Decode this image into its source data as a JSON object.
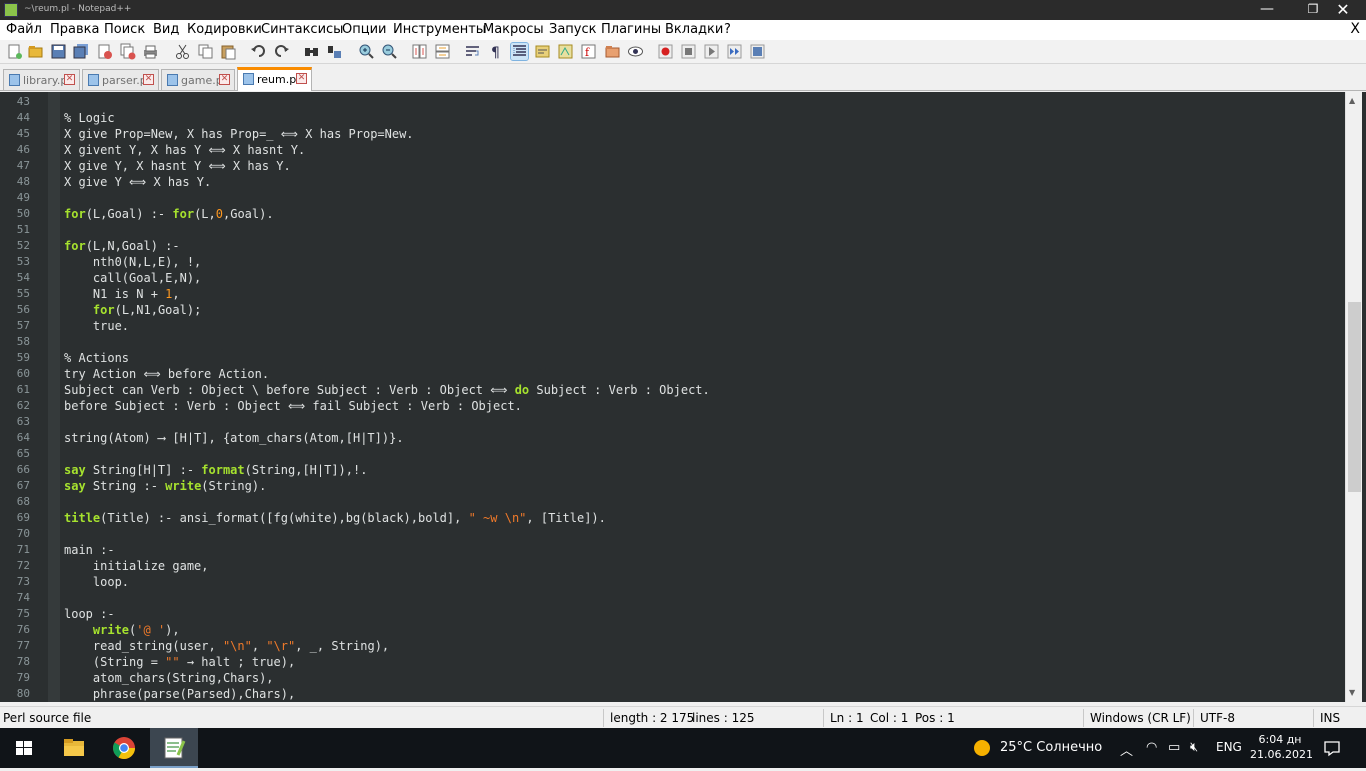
{
  "window": {
    "title": "~\\reum.pl - Notepad++",
    "controls": {
      "minimize": "—",
      "maximize": "❐",
      "close": "✕"
    }
  },
  "menu": {
    "items": [
      "Файл",
      "Правка",
      "Поиск",
      "Вид",
      "Кодировки",
      "Синтаксисы",
      "Опции",
      "Инструменты",
      "Макросы",
      "Запуск",
      "Плагины",
      "Вкладки",
      "?"
    ],
    "close_doc": "X"
  },
  "toolbar": {
    "buttons": [
      "new-file-icon",
      "open-file-icon",
      "save-icon",
      "save-all-icon",
      "close-icon",
      "close-all-icon",
      "print-icon",
      "cut-icon",
      "copy-icon",
      "paste-icon",
      "undo-icon",
      "redo-icon",
      "find-icon",
      "replace-icon",
      "zoom-in-icon",
      "zoom-out-icon",
      "sync-vertical-icon",
      "sync-horizontal-icon",
      "word-wrap-icon",
      "show-all-chars-icon",
      "indent-guide-icon",
      "udl-icon",
      "doc-map-icon",
      "function-list-icon",
      "folder-workspace-icon",
      "monitoring-icon",
      "record-macro-icon",
      "stop-macro-icon",
      "play-macro-icon",
      "run-macro-multiple-icon",
      "save-macro-icon"
    ]
  },
  "tabs": [
    {
      "label": "library.pl",
      "active": false
    },
    {
      "label": "parser.pl",
      "active": false
    },
    {
      "label": "game.pl",
      "active": false
    },
    {
      "label": "reum.pl",
      "active": true
    }
  ],
  "editor": {
    "lines": [
      {
        "n": "43",
        "parts": []
      },
      {
        "n": "44",
        "parts": [
          [
            "t",
            "% Logic"
          ]
        ]
      },
      {
        "n": "45",
        "parts": [
          [
            "t",
            "X give Prop=New, X has Prop=_ ⟺ X has Prop=New."
          ]
        ]
      },
      {
        "n": "46",
        "parts": [
          [
            "t",
            "X givent Y, X has Y ⟺ X hasnt Y."
          ]
        ]
      },
      {
        "n": "47",
        "parts": [
          [
            "t",
            "X give Y, X hasnt Y ⟺ X has Y."
          ]
        ]
      },
      {
        "n": "48",
        "parts": [
          [
            "t",
            "X give Y ⟺ X has Y."
          ]
        ]
      },
      {
        "n": "49",
        "parts": []
      },
      {
        "n": "50",
        "parts": [
          [
            "k",
            "for"
          ],
          [
            "t",
            "(L,Goal) :- "
          ],
          [
            "k",
            "for"
          ],
          [
            "t",
            "(L,"
          ],
          [
            "n",
            "0"
          ],
          [
            "t",
            ",Goal). "
          ]
        ]
      },
      {
        "n": "51",
        "parts": []
      },
      {
        "n": "52",
        "parts": [
          [
            "k",
            "for"
          ],
          [
            "t",
            "(L,N,Goal) :-"
          ]
        ]
      },
      {
        "n": "53",
        "parts": [
          [
            "t",
            "    nth0(N,L,E), !,"
          ]
        ]
      },
      {
        "n": "54",
        "parts": [
          [
            "t",
            "    call(Goal,E,N),"
          ]
        ]
      },
      {
        "n": "55",
        "parts": [
          [
            "t",
            "    N1 is N + "
          ],
          [
            "n",
            "1"
          ],
          [
            "t",
            ","
          ]
        ]
      },
      {
        "n": "56",
        "parts": [
          [
            "t",
            "    "
          ],
          [
            "k",
            "for"
          ],
          [
            "t",
            "(L,N1,Goal);"
          ]
        ]
      },
      {
        "n": "57",
        "parts": [
          [
            "t",
            "    true."
          ]
        ]
      },
      {
        "n": "58",
        "parts": []
      },
      {
        "n": "59",
        "parts": [
          [
            "t",
            "% Actions"
          ]
        ]
      },
      {
        "n": "60",
        "parts": [
          [
            "t",
            "try Action ⟺ before Action."
          ]
        ]
      },
      {
        "n": "61",
        "parts": [
          [
            "t",
            "Subject can Verb : Object \\ before Subject : Verb : Object ⟺ "
          ],
          [
            "k",
            "do"
          ],
          [
            "t",
            " Subject : Verb : Object."
          ]
        ]
      },
      {
        "n": "62",
        "parts": [
          [
            "t",
            "before Subject : Verb : Object ⟺ fail Subject : Verb : Object."
          ]
        ]
      },
      {
        "n": "63",
        "parts": []
      },
      {
        "n": "64",
        "parts": [
          [
            "t",
            "string(Atom) ⟶ [H|T], {atom_chars(Atom,[H|T])}."
          ]
        ]
      },
      {
        "n": "65",
        "parts": []
      },
      {
        "n": "66",
        "parts": [
          [
            "k",
            "say"
          ],
          [
            "t",
            " String[H|T] :- "
          ],
          [
            "k",
            "format"
          ],
          [
            "t",
            "(String,[H|T]),!."
          ]
        ]
      },
      {
        "n": "67",
        "parts": [
          [
            "k",
            "say"
          ],
          [
            "t",
            " String :- "
          ],
          [
            "k",
            "write"
          ],
          [
            "t",
            "(String)."
          ]
        ]
      },
      {
        "n": "68",
        "parts": []
      },
      {
        "n": "69",
        "parts": [
          [
            "k",
            "title"
          ],
          [
            "t",
            "(Title) :- ansi_format([fg(white),bg(black),bold], "
          ],
          [
            "s",
            "\" ~w \\n\""
          ],
          [
            "t",
            ", [Title])."
          ]
        ]
      },
      {
        "n": "70",
        "parts": []
      },
      {
        "n": "71",
        "parts": [
          [
            "t",
            "main :-"
          ]
        ]
      },
      {
        "n": "72",
        "parts": [
          [
            "t",
            "    initialize game,"
          ]
        ]
      },
      {
        "n": "73",
        "parts": [
          [
            "t",
            "    loop."
          ]
        ]
      },
      {
        "n": "74",
        "parts": []
      },
      {
        "n": "75",
        "parts": [
          [
            "t",
            "loop :-"
          ]
        ]
      },
      {
        "n": "76",
        "parts": [
          [
            "t",
            "    "
          ],
          [
            "k",
            "write"
          ],
          [
            "t",
            "("
          ],
          [
            "s",
            "'@ '"
          ],
          [
            "t",
            "),"
          ]
        ]
      },
      {
        "n": "77",
        "parts": [
          [
            "t",
            "    read_string(user, "
          ],
          [
            "s",
            "\"\\n\""
          ],
          [
            "t",
            ", "
          ],
          [
            "s",
            "\"\\r\""
          ],
          [
            "t",
            ", _, String),"
          ]
        ]
      },
      {
        "n": "78",
        "parts": [
          [
            "t",
            "    (String = "
          ],
          [
            "s",
            "\"\""
          ],
          [
            "t",
            " → halt ; true),"
          ]
        ]
      },
      {
        "n": "79",
        "parts": [
          [
            "t",
            "    atom_chars(String,Chars),"
          ]
        ]
      },
      {
        "n": "80",
        "parts": [
          [
            "t",
            "    phrase(parse(Parsed),Chars),"
          ]
        ]
      }
    ]
  },
  "status": {
    "file_type": "Perl source file",
    "length": "length : 2 175",
    "lines": "lines : 125",
    "ln": "Ln : 1",
    "col": "Col : 1",
    "pos": "Pos : 1",
    "eol": "Windows (CR LF)",
    "encoding": "UTF-8",
    "mode": "INS"
  },
  "taskbar": {
    "weather": "25°C  Солнечно",
    "lang": "ENG",
    "time": "6:04 дн",
    "date": "21.06.2021"
  },
  "colors": {
    "editor_bg": "#2b2f30",
    "keyword": "#a6e22e",
    "number": "#fd971f",
    "string": "#f07a2a",
    "active_tab_accent": "#fa8c00"
  }
}
